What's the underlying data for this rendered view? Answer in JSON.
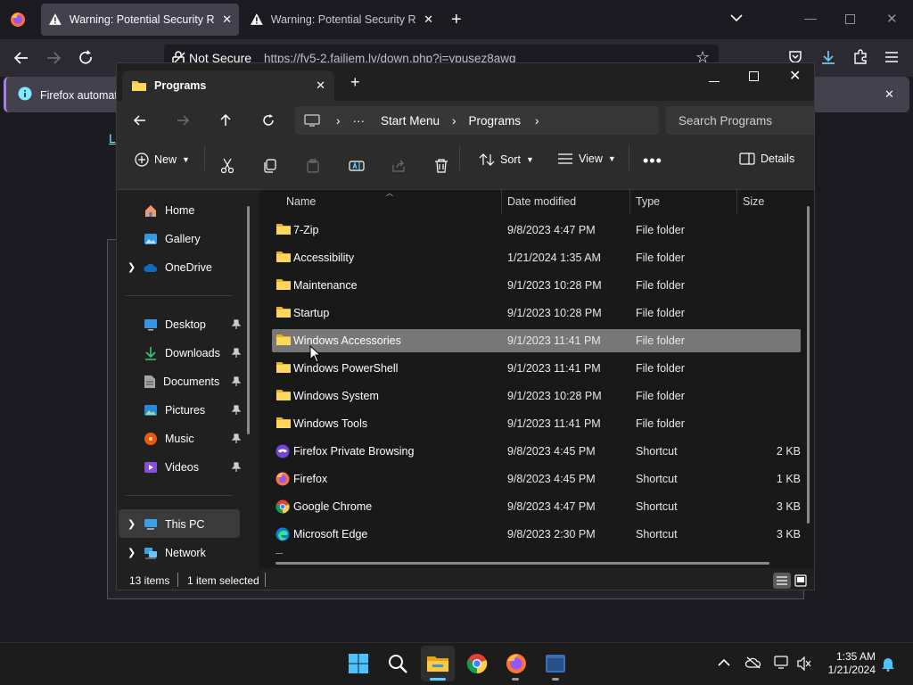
{
  "firefox": {
    "tabs": [
      {
        "title": "Warning: Potential Security Risk Ahead",
        "active": true
      },
      {
        "title": "Warning: Potential Security Risk Ahead",
        "active": false
      }
    ],
    "url_security": "Not Secure",
    "url": "https://fv5-2.failiem.lv/down.php?i=ypusez8awq",
    "infobar_text": "Firefox automatio",
    "link_stub": "L"
  },
  "explorer": {
    "tab_title": "Programs",
    "breadcrumb": [
      "Start Menu",
      "Programs"
    ],
    "search_placeholder": "Search Programs",
    "commands": {
      "new": "New",
      "sort": "Sort",
      "view": "View",
      "details": "Details"
    },
    "sidebar": {
      "home": "Home",
      "gallery": "Gallery",
      "onedrive": "OneDrive",
      "quick": [
        {
          "label": "Desktop",
          "icon": "desktop-icon"
        },
        {
          "label": "Downloads",
          "icon": "downloads-icon"
        },
        {
          "label": "Documents",
          "icon": "documents-icon"
        },
        {
          "label": "Pictures",
          "icon": "pictures-icon"
        },
        {
          "label": "Music",
          "icon": "music-icon"
        },
        {
          "label": "Videos",
          "icon": "videos-icon"
        }
      ],
      "this_pc": "This PC",
      "network": "Network"
    },
    "columns": {
      "name": "Name",
      "date": "Date modified",
      "type": "Type",
      "size": "Size"
    },
    "files": [
      {
        "name": "7-Zip",
        "date": "9/8/2023 4:47 PM",
        "type": "File folder",
        "size": "",
        "icon": "folder-icon"
      },
      {
        "name": "Accessibility",
        "date": "1/21/2024 1:35 AM",
        "type": "File folder",
        "size": "",
        "icon": "folder-icon"
      },
      {
        "name": "Maintenance",
        "date": "9/1/2023 10:28 PM",
        "type": "File folder",
        "size": "",
        "icon": "folder-icon"
      },
      {
        "name": "Startup",
        "date": "9/1/2023 10:28 PM",
        "type": "File folder",
        "size": "",
        "icon": "folder-icon"
      },
      {
        "name": "Windows Accessories",
        "date": "9/1/2023 11:41 PM",
        "type": "File folder",
        "size": "",
        "icon": "folder-icon",
        "selected": true
      },
      {
        "name": "Windows PowerShell",
        "date": "9/1/2023 11:41 PM",
        "type": "File folder",
        "size": "",
        "icon": "folder-icon"
      },
      {
        "name": "Windows System",
        "date": "9/1/2023 10:28 PM",
        "type": "File folder",
        "size": "",
        "icon": "folder-icon"
      },
      {
        "name": "Windows Tools",
        "date": "9/1/2023 11:41 PM",
        "type": "File folder",
        "size": "",
        "icon": "folder-icon"
      },
      {
        "name": "Firefox Private Browsing",
        "date": "9/8/2023 4:45 PM",
        "type": "Shortcut",
        "size": "2 KB",
        "icon": "firefox-private-icon"
      },
      {
        "name": "Firefox",
        "date": "9/8/2023 4:45 PM",
        "type": "Shortcut",
        "size": "1 KB",
        "icon": "firefox-icon"
      },
      {
        "name": "Google Chrome",
        "date": "9/8/2023 4:47 PM",
        "type": "Shortcut",
        "size": "3 KB",
        "icon": "chrome-icon"
      },
      {
        "name": "Microsoft Edge",
        "date": "9/8/2023 2:30 PM",
        "type": "Shortcut",
        "size": "3 KB",
        "icon": "edge-icon"
      }
    ],
    "status": {
      "count": "13 items",
      "selected": "1 item selected"
    }
  },
  "taskbar": {
    "time": "1:35 AM",
    "date": "1/21/2024"
  },
  "colors": {
    "accent": "#60cdff",
    "folder": "#f3c947",
    "selected_row": "#777777",
    "firefox_purple": "#a77ee4"
  }
}
